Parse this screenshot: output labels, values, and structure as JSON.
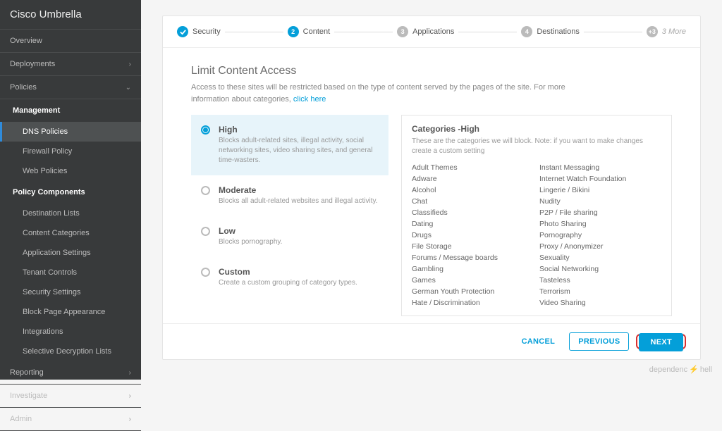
{
  "brand": "Cisco Umbrella",
  "sidebar": {
    "items": [
      {
        "label": "Overview"
      },
      {
        "label": "Deployments"
      },
      {
        "label": "Policies",
        "expanded": true
      },
      {
        "label": "Reporting"
      },
      {
        "label": "Investigate"
      },
      {
        "label": "Admin"
      }
    ],
    "sections": [
      {
        "header": "Management",
        "items": [
          "DNS Policies",
          "Firewall Policy",
          "Web Policies"
        ]
      },
      {
        "header": "Policy Components",
        "items": [
          "Destination Lists",
          "Content Categories",
          "Application Settings",
          "Tenant Controls",
          "Security Settings",
          "Block Page Appearance",
          "Integrations",
          "Selective Decryption Lists"
        ]
      }
    ],
    "active_sub": "DNS Policies"
  },
  "stepper": {
    "steps": [
      {
        "num": "✓",
        "label": "Security",
        "state": "done"
      },
      {
        "num": "2",
        "label": "Content",
        "state": "active"
      },
      {
        "num": "3",
        "label": "Applications",
        "state": "pending"
      },
      {
        "num": "4",
        "label": "Destinations",
        "state": "pending"
      },
      {
        "num": "+3",
        "label": "3 More",
        "state": "pending",
        "muted": true
      }
    ]
  },
  "heading": "Limit Content Access",
  "subtext_prefix": "Access to these sites will be restricted based on the type of content served by the pages of the site. For more information about categories, ",
  "subtext_link": "click here",
  "options": [
    {
      "title": "High",
      "desc": "Blocks adult-related sites, illegal activity, social networking sites, video sharing sites, and general time-wasters.",
      "selected": true
    },
    {
      "title": "Moderate",
      "desc": "Blocks all adult-related websites and illegal activity.",
      "selected": false
    },
    {
      "title": "Low",
      "desc": "Blocks pornography.",
      "selected": false
    },
    {
      "title": "Custom",
      "desc": "Create a custom grouping of category types.",
      "selected": false
    }
  ],
  "categories_panel": {
    "title": "Categories -High",
    "note": "These are the categories we will block. Note: if you want to make changes create a custom setting",
    "items": [
      "Adult Themes",
      "Adware",
      "Alcohol",
      "Chat",
      "Classifieds",
      "Dating",
      "Drugs",
      "File Storage",
      "Forums / Message boards",
      "Gambling",
      "Games",
      "German Youth Protection",
      "Hate / Discrimination",
      "Instant Messaging",
      "Internet Watch Foundation",
      "Lingerie / Bikini",
      "Nudity",
      "P2P / File sharing",
      "Photo Sharing",
      "Pornography",
      "Proxy / Anonymizer",
      "Sexuality",
      "Social Networking",
      "Tasteless",
      "Terrorism",
      "Video Sharing"
    ]
  },
  "footer": {
    "cancel": "CANCEL",
    "previous": "PREVIOUS",
    "next": "NEXT"
  },
  "watermark": {
    "left": "dependenc",
    "right": "hell"
  }
}
